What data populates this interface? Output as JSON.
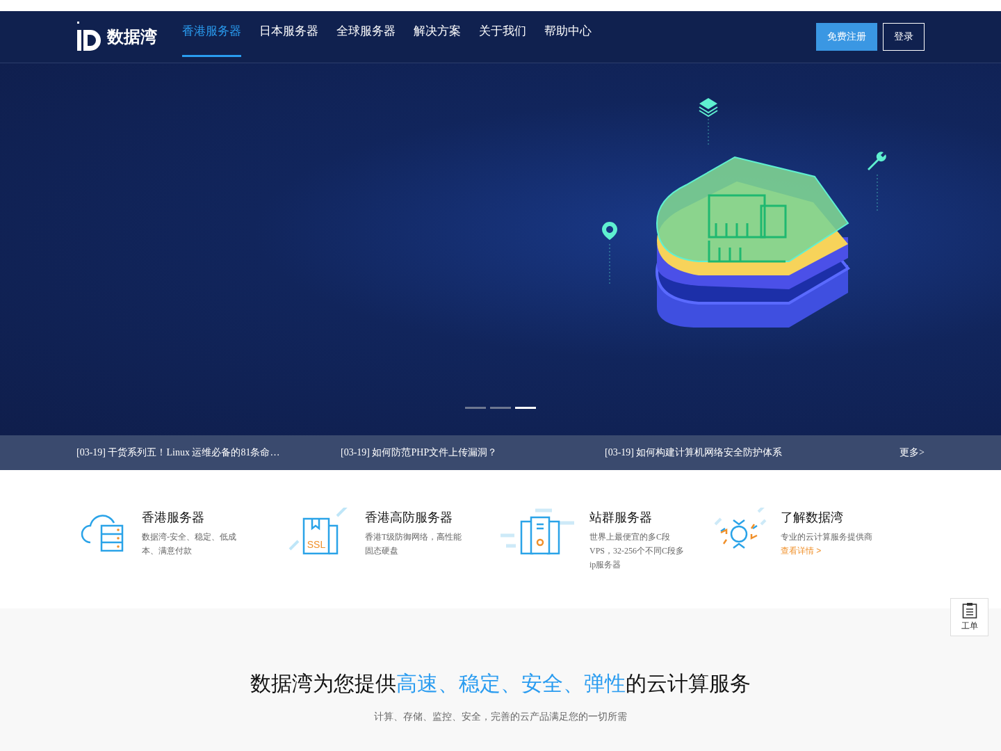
{
  "header": {
    "logo_text": "数据湾",
    "nav": [
      {
        "label": "香港服务器",
        "selected": true
      },
      {
        "label": "日本服务器",
        "selected": false
      },
      {
        "label": "全球服务器",
        "selected": false
      },
      {
        "label": "解决方案",
        "selected": false
      },
      {
        "label": "关于我们",
        "selected": false
      },
      {
        "label": "帮助中心",
        "selected": false
      }
    ],
    "register_button": "免费注册",
    "login_button": "登录"
  },
  "carousel": {
    "dots": [
      {
        "selected": false
      },
      {
        "selected": false
      },
      {
        "selected": true
      }
    ]
  },
  "news": {
    "items": [
      "[03-19] 干货系列五！Linux 运维必备的81条命…",
      "[03-19] 如何防范PHP文件上传漏洞？",
      "[03-19] 如何构建计算机网络安全防护体系"
    ],
    "more": "更多>"
  },
  "features": [
    {
      "kind": "cloud",
      "title": "香港服务器",
      "desc": "数据湾-安全、稳定、低成本、满意付款"
    },
    {
      "kind": "ssl",
      "icon_label": "SSL",
      "title": "香港高防服务器",
      "desc": "香港T级防御网络，高性能固态硬盘"
    },
    {
      "kind": "building",
      "title": "站群服务器",
      "desc": "世界上最便宜的多C段VPS，32-256个不同C段多ip服务器"
    },
    {
      "kind": "sun",
      "title": "了解数据湾",
      "desc": "专业的云计算服务提供商",
      "link": "查看详情 >"
    }
  ],
  "intro": {
    "heading": [
      {
        "text": "数据湾为您提供",
        "highlight": false
      },
      {
        "text": "高速、稳定、安全、弹性",
        "highlight": true
      },
      {
        "text": "的云计算服务",
        "highlight": false
      }
    ],
    "subtitle": "计算、存储、监控、安全，完善的云产品满足您的一切所需"
  },
  "ticket_button": {
    "label": "工单"
  }
}
